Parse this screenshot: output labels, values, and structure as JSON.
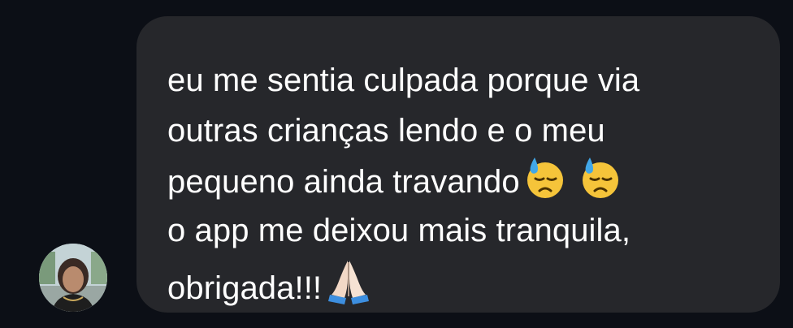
{
  "chat": {
    "message": {
      "lines": [
        "eu me sentia culpada porque via",
        "outras crianças lendo e o meu",
        "pequeno ainda travando",
        "o app me deixou mais tranquila,",
        "obrigada!!!"
      ],
      "emojis_line_3": [
        "downcast-face-with-sweat-emoji",
        "downcast-face-with-sweat-emoji"
      ],
      "emoji_line_5": "folded-hands-emoji"
    },
    "sender": {
      "avatar": "user-avatar-photo"
    }
  },
  "colors": {
    "background": "#0c0f16",
    "bubble": "#26272b",
    "text": "#ffffff"
  }
}
